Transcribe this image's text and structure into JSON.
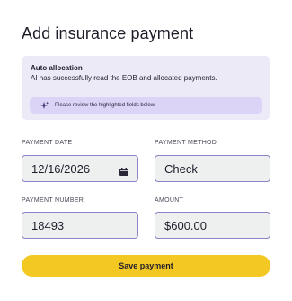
{
  "page": {
    "title": "Add insurance payment"
  },
  "alert": {
    "title": "Auto allocation",
    "message": "AI has successfully read the EOB and allocated payments.",
    "note": "Please review the highlighted fields below.",
    "note_icon": "sparkle-icon"
  },
  "form": {
    "payment_date": {
      "label": "PAYMENT DATE",
      "value": "12/16/2026",
      "icon": "calendar-icon"
    },
    "payment_method": {
      "label": "PAYMENT METHOD",
      "value": "Check"
    },
    "payment_number": {
      "label": "PAYMENT NUMBER",
      "value": "18493"
    },
    "amount": {
      "label": "AMOUNT",
      "value": "$600.00"
    }
  },
  "actions": {
    "save_label": "Save payment"
  },
  "colors": {
    "accent_yellow": "#f4c823",
    "alert_bg": "#eceaf7",
    "note_bg": "#dcd4f6",
    "field_border": "#8b84c8",
    "field_bg": "#eef0f0"
  }
}
